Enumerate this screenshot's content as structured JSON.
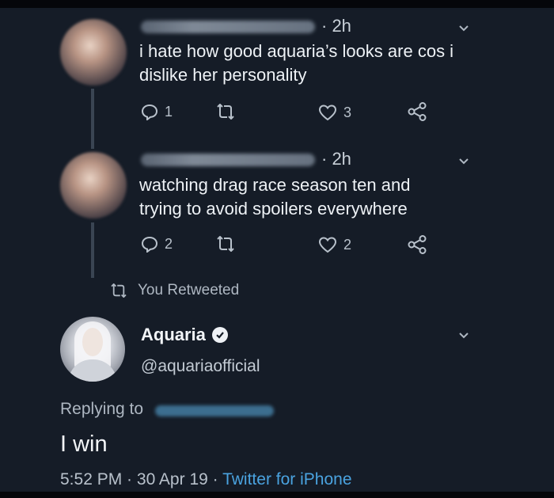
{
  "tweets": [
    {
      "time": "· 2h",
      "text_line1": "i hate how good aquaria’s looks are cos i",
      "text_line2": "dislike her personality",
      "reply_count": "1",
      "retweet_count": "",
      "like_count": "3"
    },
    {
      "time": "· 2h",
      "text_line1": "watching drag race season ten and",
      "text_line2": "trying to avoid spoilers everywhere",
      "reply_count": "2",
      "retweet_count": "",
      "like_count": "2"
    }
  ],
  "retweet_notice": "You Retweeted",
  "main_tweet": {
    "display_name": "Aquaria",
    "handle": "@aquariaofficial",
    "replying_to_label": "Replying to",
    "text": "I win",
    "time": "5:52 PM",
    "date": "30 Apr 19",
    "separator": " · ",
    "source": "Twitter for iPhone",
    "verified_icon": "verified-check-icon"
  },
  "colors": {
    "background": "#151c27",
    "link": "#4aa3e0",
    "text": "#eef2f6",
    "muted": "#aeb7c2"
  }
}
